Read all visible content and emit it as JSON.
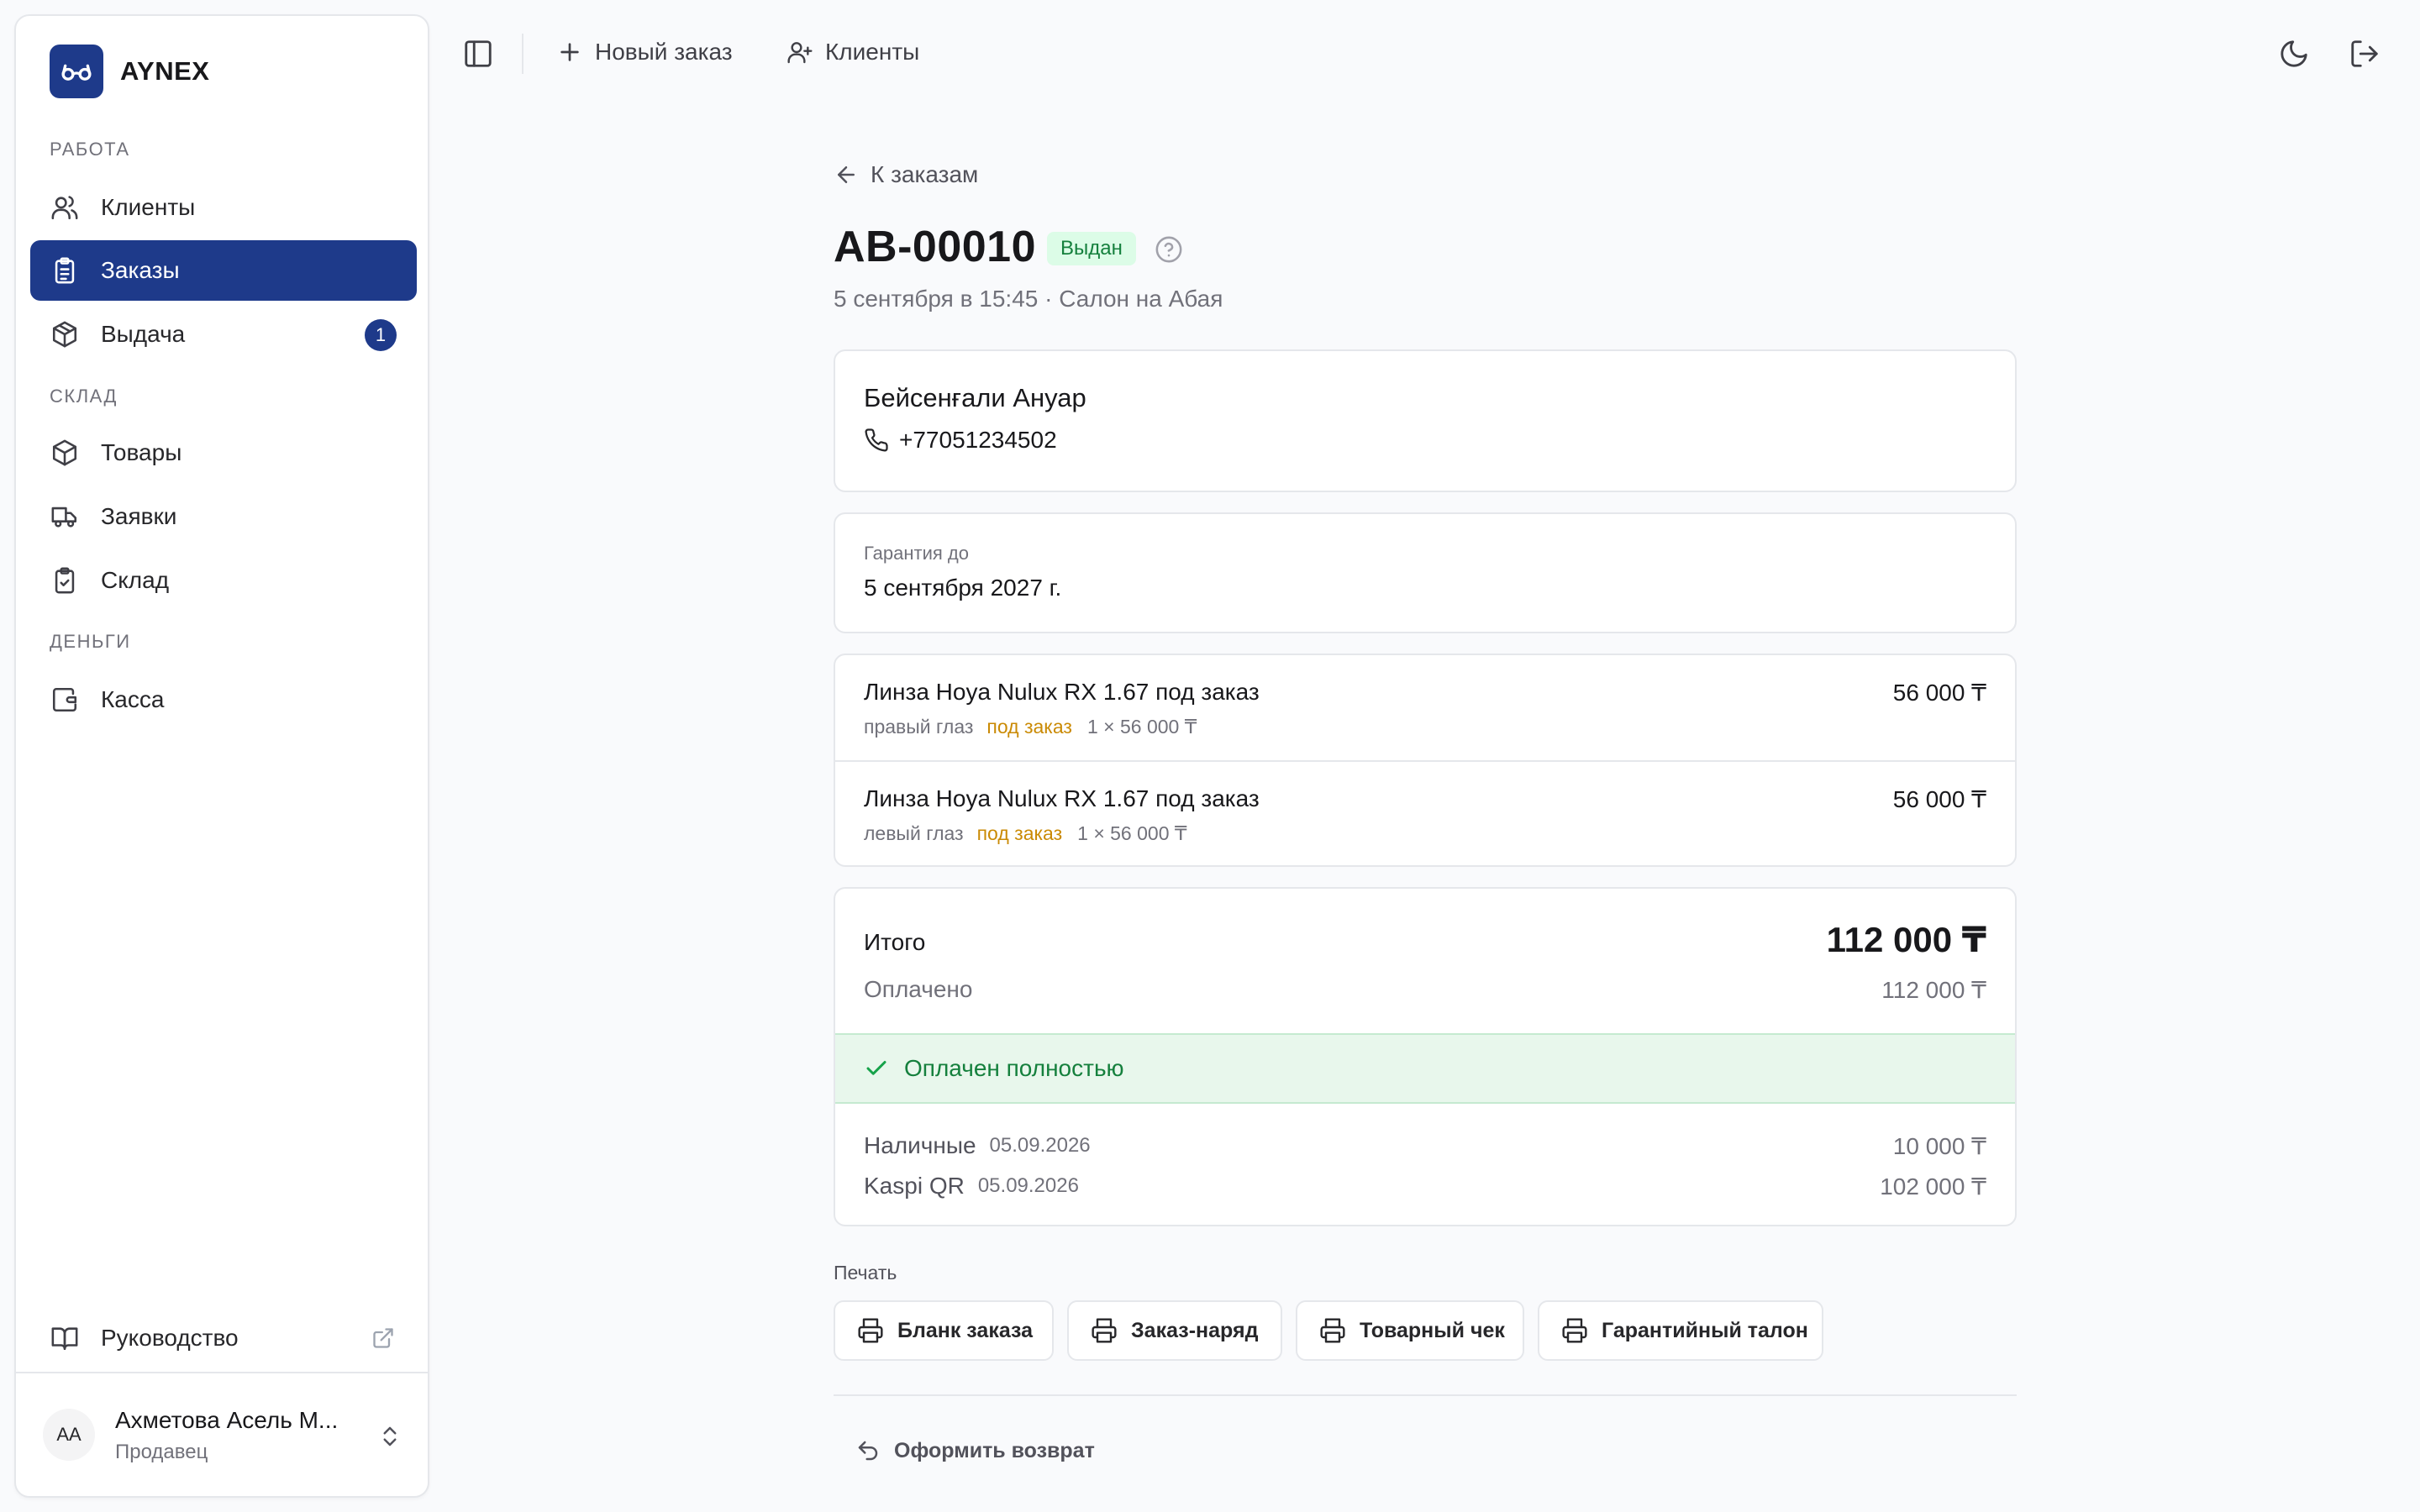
{
  "brand": {
    "name": "AYNEX",
    "logo_icon": "glasses-icon",
    "accent": "#1e3a8a"
  },
  "sidebar": {
    "sections": [
      "РАБОТА",
      "СКЛАД",
      "ДЕНЬГИ"
    ],
    "items": [
      {
        "label": "Клиенты",
        "icon": "users-icon"
      },
      {
        "label": "Заказы",
        "icon": "clipboard-list-icon",
        "active": true
      },
      {
        "label": "Выдача",
        "icon": "package-open-icon",
        "badge": "1"
      },
      {
        "label": "Товары",
        "icon": "package-icon"
      },
      {
        "label": "Заявки",
        "icon": "truck-icon"
      },
      {
        "label": "Склад",
        "icon": "clipboard-check-icon"
      },
      {
        "label": "Касса",
        "icon": "wallet-icon"
      }
    ],
    "guide": {
      "label": "Руководство",
      "icon": "book-open-icon"
    },
    "user": {
      "initials": "АА",
      "name": "Ахметова Асель М...",
      "role": "Продавец"
    }
  },
  "topbar": {
    "new_order": "Новый заказ",
    "clients": "Клиенты"
  },
  "order": {
    "back_label": "К заказам",
    "number": "АВ-00010",
    "status": "Выдан",
    "meta": "5 сентября в 15:45 · Салон на Абая",
    "client": {
      "name": "Бейсенғали Ануар",
      "phone": "+77051234502"
    },
    "warranty": {
      "label": "Гарантия до",
      "value": "5 сентября 2027 г."
    },
    "items": [
      {
        "name": "Линза Hoya Nulux RX 1.67 под заказ",
        "eye": "правый глаз",
        "tag": "под заказ",
        "qty": "1 × 56 000 ₸",
        "price": "56 000 ₸"
      },
      {
        "name": "Линза Hoya Nulux RX 1.67 под заказ",
        "eye": "левый глаз",
        "tag": "под заказ",
        "qty": "1 × 56 000 ₸",
        "price": "56 000 ₸"
      }
    ],
    "totals": {
      "total_label": "Итого",
      "total_value": "112 000 ₸",
      "paid_label": "Оплачено",
      "paid_value": "112 000 ₸",
      "paid_status": "Оплачен полностью"
    },
    "payments": [
      {
        "method": "Наличные",
        "date": "05.09.2026",
        "amount": "10 000 ₸"
      },
      {
        "method": "Kaspi QR",
        "date": "05.09.2026",
        "amount": "102 000 ₸"
      }
    ],
    "print": {
      "label": "Печать",
      "buttons": [
        "Бланк заказа",
        "Заказ-наряд",
        "Товарный чек",
        "Гарантийный талон"
      ]
    },
    "return_label": "Оформить возврат"
  }
}
